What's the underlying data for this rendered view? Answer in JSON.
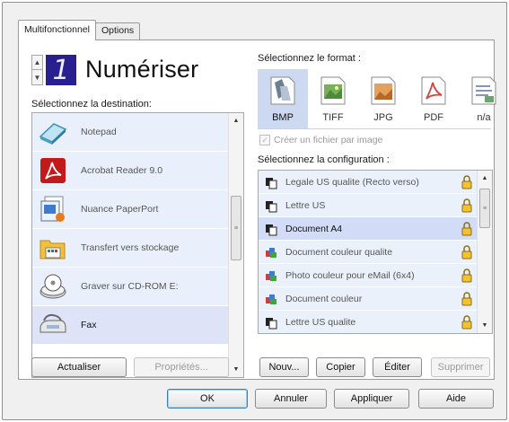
{
  "tabs": [
    {
      "label": "Multifonctionnel",
      "active": true
    },
    {
      "label": "Options",
      "active": false
    }
  ],
  "action": {
    "number": "1",
    "title": "Numériser"
  },
  "destination": {
    "label": "Sélectionnez la destination:",
    "items": [
      {
        "label": "Notepad",
        "icon": "notepad-icon"
      },
      {
        "label": "Acrobat Reader 9.0",
        "icon": "acrobat-icon"
      },
      {
        "label": "Nuance PaperPort",
        "icon": "paperport-icon"
      },
      {
        "label": "Transfert vers stockage",
        "icon": "folder-storage-icon"
      },
      {
        "label": "Graver sur CD-ROM  E:",
        "icon": "cd-burn-icon"
      },
      {
        "label": "Fax",
        "icon": "fax-icon",
        "selected": true
      }
    ],
    "refresh_button": "Actualiser",
    "properties_button": "Propriétés..."
  },
  "format": {
    "label": "Sélectionnez le format :",
    "items": [
      {
        "label": "BMP",
        "selected": true
      },
      {
        "label": "TIFF"
      },
      {
        "label": "JPG"
      },
      {
        "label": "PDF"
      },
      {
        "label": "n/a"
      }
    ],
    "checkbox_label": "Créer un fichier par image"
  },
  "configuration": {
    "label": "Sélectionnez la configuration :",
    "items": [
      {
        "label": "Legale US qualite (Recto verso)",
        "icon": "bw-document-icon"
      },
      {
        "label": "Lettre US",
        "icon": "bw-document-icon"
      },
      {
        "label": "Document A4",
        "icon": "bw-document-icon",
        "selected": true
      },
      {
        "label": "Document couleur qualite",
        "icon": "color-document-icon"
      },
      {
        "label": "Photo couleur pour eMail (6x4)",
        "icon": "color-document-icon"
      },
      {
        "label": "Document couleur",
        "icon": "color-document-icon"
      },
      {
        "label": "Lettre US qualite",
        "icon": "bw-document-icon"
      }
    ],
    "new_button": "Nouv...",
    "copy_button": "Copier",
    "edit_button": "Éditer",
    "delete_button": "Supprimer"
  },
  "footer": {
    "ok": "OK",
    "cancel": "Annuler",
    "apply": "Appliquer",
    "help": "Aide"
  },
  "colors": {
    "selection": "#cdd9f0",
    "list_item": "#eaf0fb",
    "digit_bg": "#2a1f8f"
  }
}
